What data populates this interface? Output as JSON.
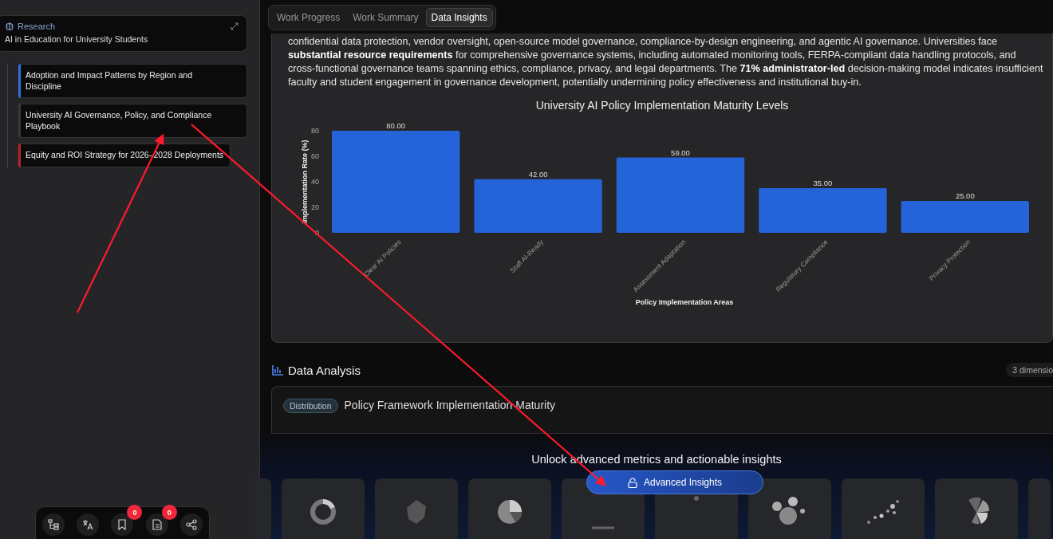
{
  "sidebar": {
    "header": {
      "label": "Research",
      "title": "AI in Education for University Students"
    },
    "items": [
      {
        "label": "Adoption and Impact Patterns by Region and Discipline",
        "color": "#2f6fe0"
      },
      {
        "label": "University AI Governance, Policy, and Compliance Playbook",
        "color": "#3a3a3e"
      },
      {
        "label": "Equity and ROI Strategy for 2026–2028 Deployments",
        "color": "#c0202a"
      }
    ],
    "toolbar": [
      {
        "kind": "tree"
      },
      {
        "kind": "translate"
      },
      {
        "kind": "bookmark",
        "badge": "0"
      },
      {
        "kind": "document",
        "badge": "0"
      },
      {
        "kind": "share"
      }
    ]
  },
  "tabs": [
    {
      "label": "Work Progress",
      "selected": false
    },
    {
      "label": "Work Summary",
      "selected": false
    },
    {
      "label": "Data Insights",
      "selected": true
    }
  ],
  "paragraph": "confidential data protection, vendor oversight, open-source model governance, compliance-by-design engineering, and agentic AI governance. Universities face **substantial resource requirements** for comprehensive governance systems, including automated monitoring tools, FERPA-compliant data handling protocols, and cross-functional governance teams spanning ethics, compliance, privacy, and legal departments. The **71% administrator-led** decision-making model indicates insufficient faculty and student engagement in governance development, potentially undermining policy effectiveness and institutional buy-in.",
  "chart_data": {
    "type": "bar",
    "title": "University AI Policy Implementation Maturity Levels",
    "xlabel": "Policy Implementation Areas",
    "ylabel": "Implementation Rate (%)",
    "categories": [
      "Clear AI Policies",
      "Staff AI-Ready",
      "Assessment Adaptation",
      "Regulatory Compliance",
      "Privacy Protection"
    ],
    "values": [
      80,
      42,
      59,
      35,
      25
    ],
    "value_labels": [
      "80.00",
      "42.00",
      "59.00",
      "35.00",
      "25.00"
    ],
    "ylim": [
      0,
      80
    ],
    "yticks": [
      0,
      20,
      40,
      60,
      80
    ]
  },
  "analysis": {
    "title": "Data Analysis",
    "count": "3 dimensio",
    "card": {
      "badge": "Distribution",
      "title": "Policy Framework Implementation Maturity"
    }
  },
  "upsell": {
    "message": "Unlock advanced metrics and actionable insights",
    "button": "Advanced Insights",
    "thumbnails": [
      {
        "kind": "partial"
      },
      {
        "kind": "donut"
      },
      {
        "kind": "polygon"
      },
      {
        "kind": "pie"
      },
      {
        "kind": "bars"
      },
      {
        "kind": "dots"
      },
      {
        "kind": "bubbles"
      },
      {
        "kind": "scatter"
      },
      {
        "kind": "rose"
      },
      {
        "kind": "partial"
      }
    ]
  }
}
